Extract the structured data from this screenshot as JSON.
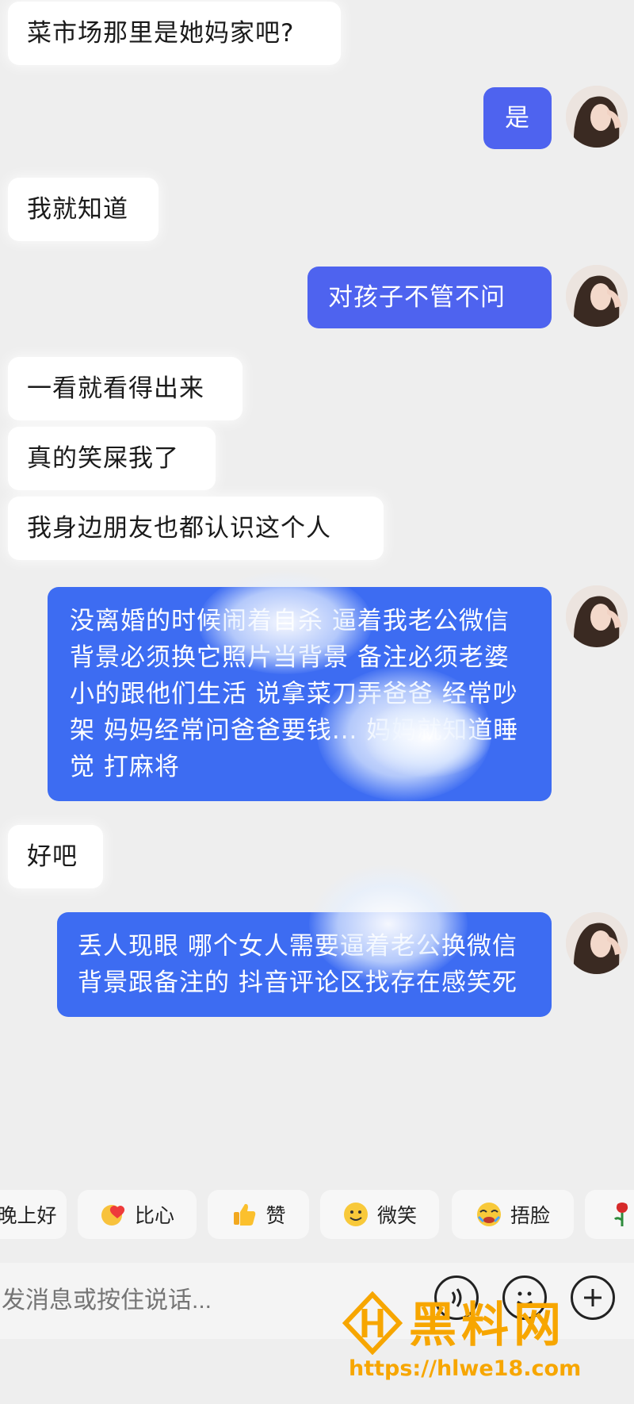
{
  "messages": {
    "m1": "菜市场那里是她妈家吧?",
    "m2": "是",
    "m3": "我就知道",
    "m4": "对孩子不管不问",
    "m5": "一看就看得出来",
    "m6": "真的笑屎我了",
    "m7": "我身边朋友也都认识这个人",
    "m8": "没离婚的时候闹着自杀 逼着我老公微信背景必须换它照片当背景 备注必须老婆 小的跟他们生活 说拿菜刀弄爸爸 经常吵架 妈妈经常问爸爸要钱... 妈妈就知道睡觉 打麻将",
    "m9": "好吧",
    "m10": "丢人现眼 哪个女人需要逼着老公换微信背景跟备注的 抖音评论区找存在感笑死"
  },
  "reactions": [
    {
      "label": "晚上好",
      "icon": "moon-icon"
    },
    {
      "label": "比心",
      "icon": "heart-hand-icon"
    },
    {
      "label": "赞",
      "icon": "thumbs-up-icon"
    },
    {
      "label": "微笑",
      "icon": "smile-icon"
    },
    {
      "label": "捂脸",
      "icon": "facepalm-icon"
    },
    {
      "label": "",
      "icon": "rose-icon"
    }
  ],
  "input": {
    "placeholder": "发消息或按住说话..."
  },
  "watermark": {
    "brand": "黑料网",
    "url": "https://hlwe18.com"
  },
  "colors": {
    "outgoing_bubble": "#3d6cf2",
    "incoming_bubble": "#ffffff",
    "background": "#eeeeee",
    "watermark": "#f7a600"
  }
}
